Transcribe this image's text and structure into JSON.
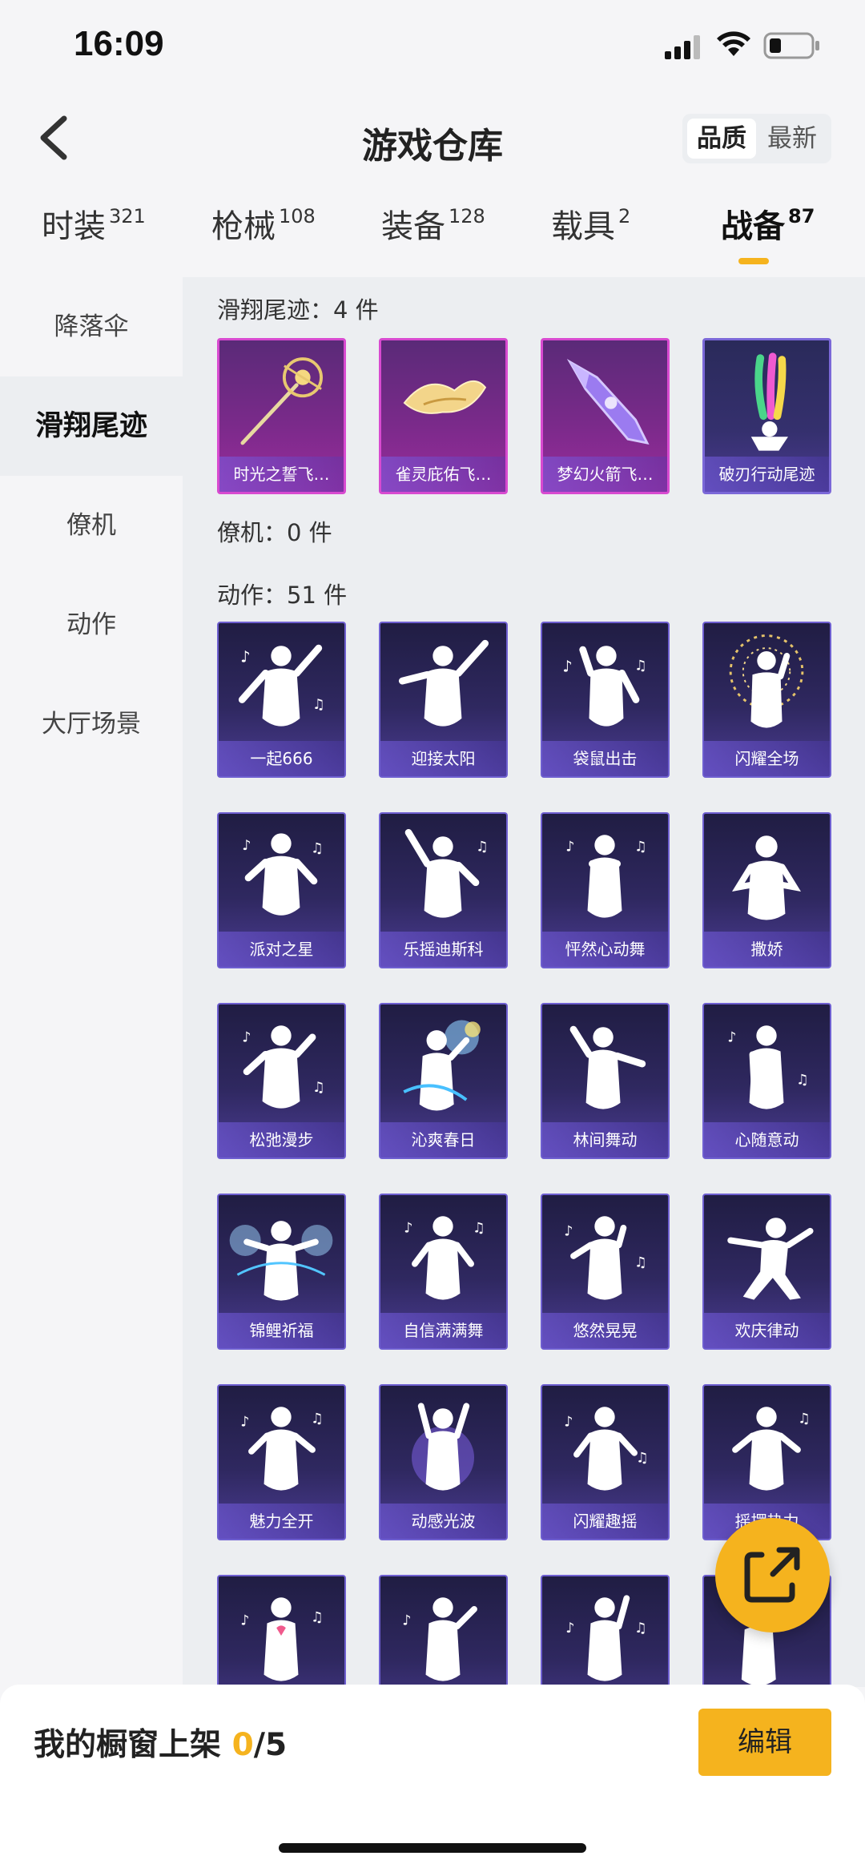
{
  "status_bar": {
    "time": "16:09"
  },
  "header": {
    "title": "游戏仓库",
    "sort_options": [
      "品质",
      "最新"
    ],
    "sort_selected": "品质"
  },
  "tabs": [
    {
      "label": "时装",
      "count": "321"
    },
    {
      "label": "枪械",
      "count": "108"
    },
    {
      "label": "装备",
      "count": "128"
    },
    {
      "label": "载具",
      "count": "2"
    },
    {
      "label": "战备",
      "count": "87",
      "active": true
    }
  ],
  "side_menu": [
    {
      "label": "降落伞"
    },
    {
      "label": "滑翔尾迹",
      "active": true
    },
    {
      "label": "僚机"
    },
    {
      "label": "动作"
    },
    {
      "label": "大厅场景"
    }
  ],
  "sections": {
    "glide": {
      "header": "滑翔尾迹：4 件",
      "items": [
        "时光之誓飞…",
        "雀灵庇佑飞…",
        "梦幻火箭飞…",
        "破刃行动尾迹"
      ]
    },
    "wingman": {
      "header": "僚机：0 件"
    },
    "action": {
      "header": "动作：51 件",
      "items": [
        "一起666",
        "迎接太阳",
        "袋鼠出击",
        "闪耀全场",
        "派对之星",
        "乐摇迪斯科",
        "怦然心动舞",
        "撒娇",
        "松弛漫步",
        "沁爽春日",
        "林间舞动",
        "心随意动",
        "锦鲤祈福",
        "自信满满舞",
        "悠然晃晃",
        "欢庆律动",
        "魅力全开",
        "动感光波",
        "闪耀趣摇",
        "摇摆热力"
      ]
    }
  },
  "bottom_bar": {
    "label": "我的橱窗上架",
    "count_current": "0",
    "count_total": "/5",
    "edit_label": "编辑"
  },
  "icons": {
    "back": "chevron-left-icon",
    "share": "share-external-icon",
    "signal": "cellular-signal-icon",
    "wifi": "wifi-icon",
    "battery": "battery-icon"
  },
  "colors": {
    "accent": "#f5b31e",
    "rare_border": "#d84ad0",
    "epic_border": "#7b68d8"
  }
}
